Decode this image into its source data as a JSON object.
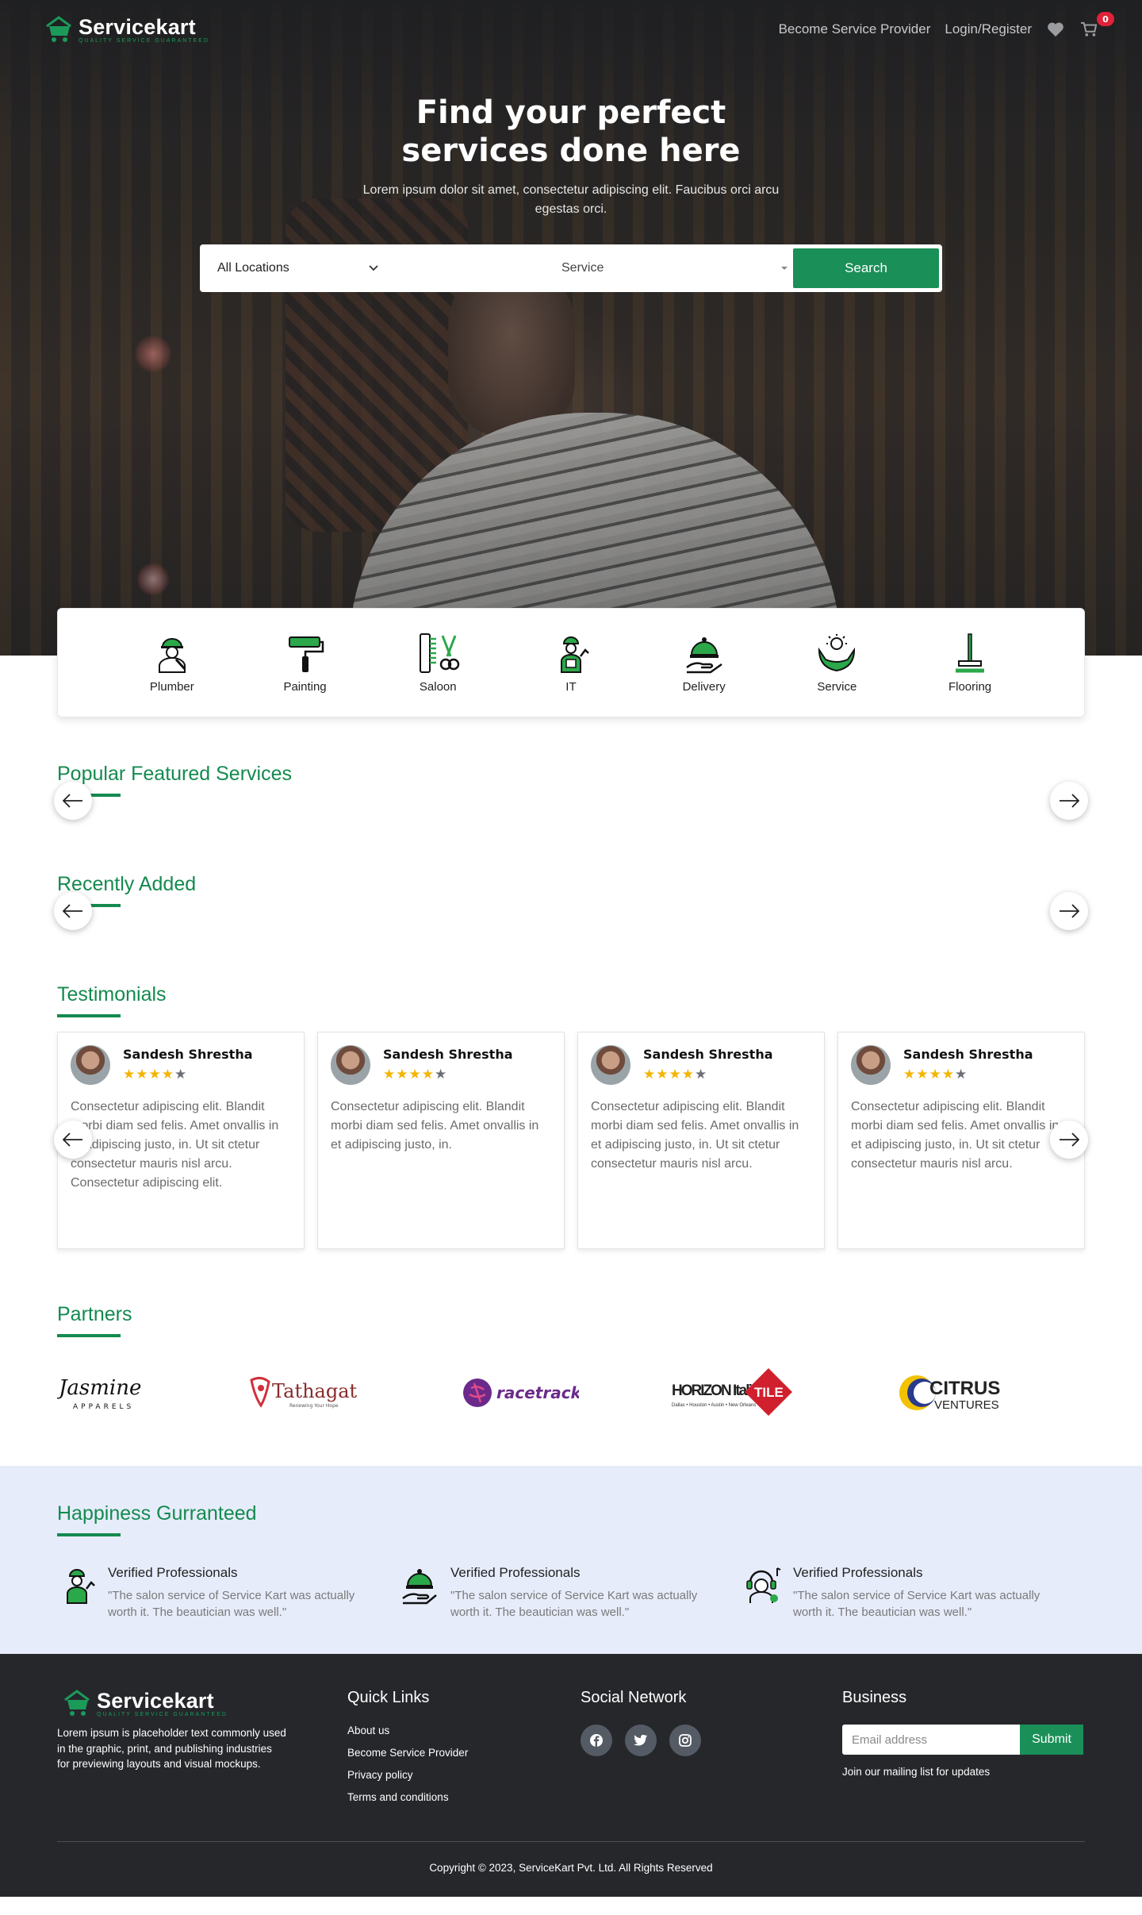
{
  "brand": {
    "name": "Servicekart",
    "tagline": "QUALITY SERVICE GUARANTEED",
    "accent_color": "#1a8f58"
  },
  "nav": {
    "become_provider": "Become Service Provider",
    "login": "Login/Register",
    "cart_count": "0",
    "wishlist_icon": "heart-icon",
    "cart_icon": "cart-icon"
  },
  "hero": {
    "title": "Find your perfect services done here",
    "subtitle": "Lorem ipsum dolor sit amet, consectetur adipiscing elit. Faucibus orci arcu egestas orci."
  },
  "search": {
    "location_value": "All Locations",
    "service_value": "Service",
    "button_label": "Search"
  },
  "categories": [
    {
      "label": "Plumber",
      "icon": "plumber-icon"
    },
    {
      "label": "Painting",
      "icon": "paint-roller-icon"
    },
    {
      "label": "Saloon",
      "icon": "scissors-comb-icon"
    },
    {
      "label": "IT",
      "icon": "it-worker-icon"
    },
    {
      "label": "Delivery",
      "icon": "delivery-cloche-icon"
    },
    {
      "label": "Service",
      "icon": "care-hands-icon"
    },
    {
      "label": "Flooring",
      "icon": "mop-icon"
    }
  ],
  "sections": {
    "popular": "Popular Featured Services",
    "recent": "Recently Added",
    "testimonials": "Testimonials",
    "partners": "Partners",
    "happiness": "Happiness Gurranteed"
  },
  "testimonials": [
    {
      "name": "Sandesh Shrestha",
      "rating": 4,
      "text": "Consectetur adipiscing elit. Blandit morbi diam sed felis. Amet onvallis in et adipiscing justo, in. Ut sit ctetur consectetur mauris nisl arcu. Consectetur adipiscing elit."
    },
    {
      "name": "Sandesh Shrestha",
      "rating": 4,
      "text": "Consectetur adipiscing elit. Blandit morbi diam sed felis. Amet onvallis in et adipiscing justo, in."
    },
    {
      "name": "Sandesh Shrestha",
      "rating": 4,
      "text": "Consectetur adipiscing elit. Blandit morbi diam sed felis. Amet onvallis in et adipiscing justo, in. Ut sit ctetur consectetur mauris nisl arcu."
    },
    {
      "name": "Sandesh Shrestha",
      "rating": 4,
      "text": "Consectetur adipiscing elit. Blandit morbi diam sed felis. Amet onvallis in et adipiscing justo, in. Ut sit ctetur consectetur mauris nisl arcu."
    }
  ],
  "partners": [
    {
      "name": "Jasmine",
      "sub": "APPARELS"
    },
    {
      "name": "Tathagat",
      "sub": "Renewing Your Hope"
    },
    {
      "name": "racetrack",
      "sub": ""
    },
    {
      "name": "HORIZON Italian",
      "mark": "TILE",
      "sub": "Dallas • Houston • Austin • New Orleans"
    },
    {
      "name": "CITRUS",
      "sub": "VENTURES"
    }
  ],
  "happiness": [
    {
      "title": "Verified Professionals",
      "text": "\"The salon service of Service Kart was actually worth it. The beautician was well.\"",
      "icon": "it-worker-icon"
    },
    {
      "title": "Verified Professionals",
      "text": "\"The salon service of Service Kart was actually worth it. The beautician was well.\"",
      "icon": "delivery-cloche-icon"
    },
    {
      "title": "Verified Professionals",
      "text": "\"The salon service of Service Kart was actually worth it. The beautician was well.\"",
      "icon": "support-agent-icon"
    }
  ],
  "footer": {
    "desc": "Lorem ipsum is placeholder text commonly used in the graphic, print, and publishing industries for previewing layouts and visual mockups.",
    "quick_links_title": "Quick Links",
    "quick_links": [
      "About us",
      "Become Service Provider",
      "Privacy policy",
      "Terms and conditions"
    ],
    "social_title": "Social Network",
    "social": [
      "facebook-icon",
      "twitter-icon",
      "instagram-icon"
    ],
    "business_title": "Business",
    "email_placeholder": "Email address",
    "submit_label": "Submit",
    "mailing_note": "Join our mailing list for updates",
    "copyright": "Copyright © 2023, ServiceKart Pvt. Ltd. All Rights Reserved"
  }
}
